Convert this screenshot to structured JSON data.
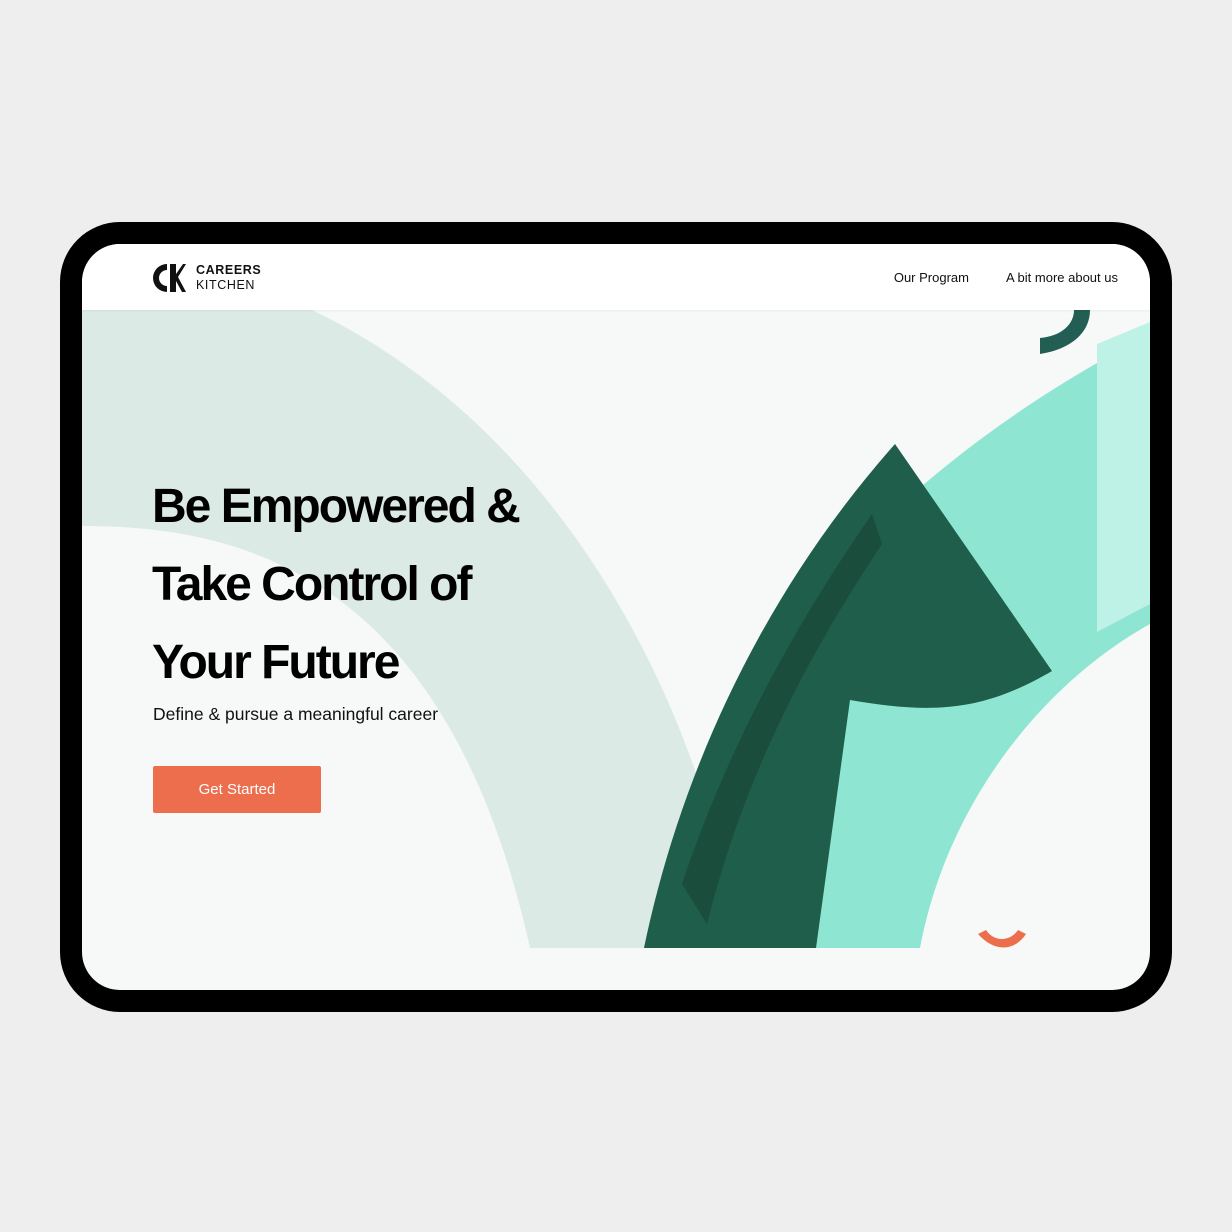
{
  "brand": {
    "line1": "CAREERS",
    "line2": "KITCHEN",
    "logo_icon": "ck-logo-icon"
  },
  "nav": {
    "items": [
      "Our Program",
      "A bit more about us"
    ]
  },
  "hero": {
    "title_lines": [
      "Be Empowered &",
      "Take Control of",
      "Your Future"
    ],
    "subtitle": "Define & pursue a meaningful career",
    "cta_label": "Get Started"
  },
  "colors": {
    "accent": "#ec6e4d",
    "dark_green": "#1e5e4a",
    "mint": "#8ee6d2",
    "pale_mint": "#dceae6",
    "background": "#f7f9f8",
    "frame": "#000000",
    "page_bg": "#eeeeee"
  }
}
